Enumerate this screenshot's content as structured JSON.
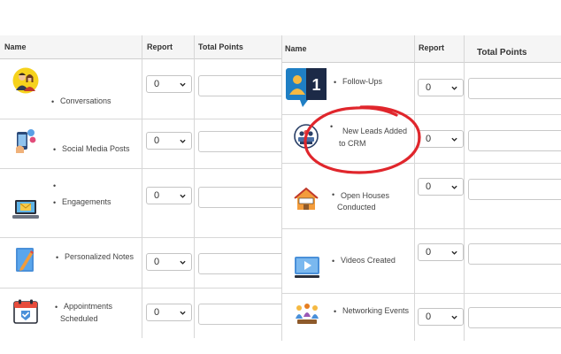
{
  "left": {
    "headers": {
      "name": "Name",
      "report": "Report",
      "total": "Total Points"
    },
    "rows": [
      {
        "label_lines": [
          "Conversations"
        ],
        "value": "0"
      },
      {
        "label_lines": [
          "Social Media Posts"
        ],
        "value": "0"
      },
      {
        "label_lines": [
          "Engagements"
        ],
        "value": "0"
      },
      {
        "label_lines": [
          "Personalized Notes"
        ],
        "value": "0"
      },
      {
        "label_lines": [
          "Appointments",
          "Scheduled"
        ],
        "value": "0"
      }
    ]
  },
  "right": {
    "headers": {
      "name": "Name",
      "report": "Report",
      "total": "Total Points"
    },
    "rows": [
      {
        "label_lines": [
          "Follow-Ups"
        ],
        "value": "0",
        "badge": "1"
      },
      {
        "label_lines": [
          "New Leads Added",
          "to CRM"
        ],
        "value": "0"
      },
      {
        "label_lines": [
          "Open Houses",
          "Conducted"
        ],
        "value": "0"
      },
      {
        "label_lines": [
          "Videos Created"
        ],
        "value": "0"
      },
      {
        "label_lines": [
          "Networking Events"
        ],
        "value": "0"
      }
    ]
  },
  "bullet": "•",
  "annotation_color": "#e0262c"
}
